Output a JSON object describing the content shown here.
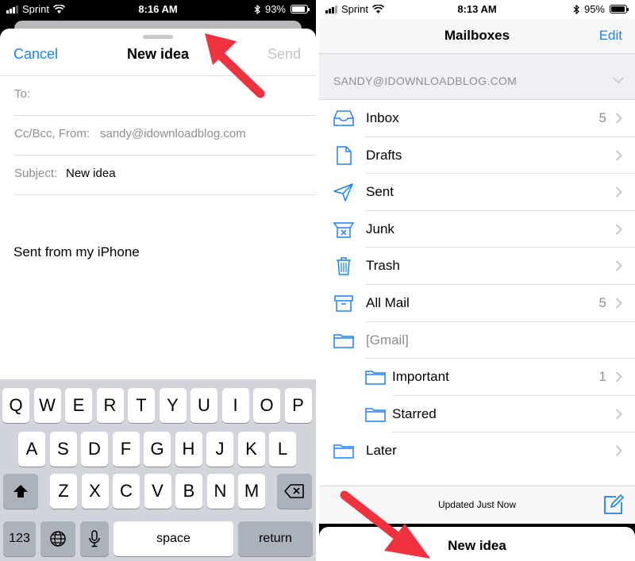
{
  "left": {
    "status": {
      "carrier": "Sprint",
      "time": "8:16 AM",
      "battery": "93%"
    },
    "compose": {
      "cancel": "Cancel",
      "title": "New idea",
      "send": "Send",
      "to_label": "To:",
      "ccbcc_label": "Cc/Bcc, From:",
      "from_value": "sandy@idownloadblog.com",
      "subject_label": "Subject:",
      "subject_value": "New idea",
      "body": "Sent from my iPhone"
    },
    "keyboard": {
      "row1": [
        "Q",
        "W",
        "E",
        "R",
        "T",
        "Y",
        "U",
        "I",
        "O",
        "P"
      ],
      "row2": [
        "A",
        "S",
        "D",
        "F",
        "G",
        "H",
        "J",
        "K",
        "L"
      ],
      "row3": [
        "Z",
        "X",
        "C",
        "V",
        "B",
        "N",
        "M"
      ],
      "numbers": "123",
      "space": "space",
      "return": "return"
    }
  },
  "right": {
    "status": {
      "carrier": "Sprint",
      "time": "8:13 AM",
      "battery": "95%"
    },
    "nav": {
      "title": "Mailboxes",
      "edit": "Edit"
    },
    "account": "SANDY@IDOWNLOADBLOG.COM",
    "mailboxes": [
      {
        "label": "Inbox",
        "count": "5",
        "icon": "inbox-icon"
      },
      {
        "label": "Drafts",
        "count": "",
        "icon": "drafts-icon"
      },
      {
        "label": "Sent",
        "count": "",
        "icon": "sent-icon"
      },
      {
        "label": "Junk",
        "count": "",
        "icon": "junk-icon"
      },
      {
        "label": "Trash",
        "count": "",
        "icon": "trash-icon"
      },
      {
        "label": "All Mail",
        "count": "5",
        "icon": "archive-icon"
      },
      {
        "label": "[Gmail]",
        "count": "",
        "icon": "folder-icon"
      },
      {
        "label": "Important",
        "count": "1",
        "icon": "folder-icon"
      },
      {
        "label": "Starred",
        "count": "",
        "icon": "folder-icon"
      },
      {
        "label": "Later",
        "count": "",
        "icon": "folder-icon"
      }
    ],
    "toolbar": {
      "updated": "Updated Just Now"
    },
    "minimized_draft": "New idea"
  },
  "colors": {
    "accent": "#1a82fb",
    "arrow": "#f0323f"
  }
}
